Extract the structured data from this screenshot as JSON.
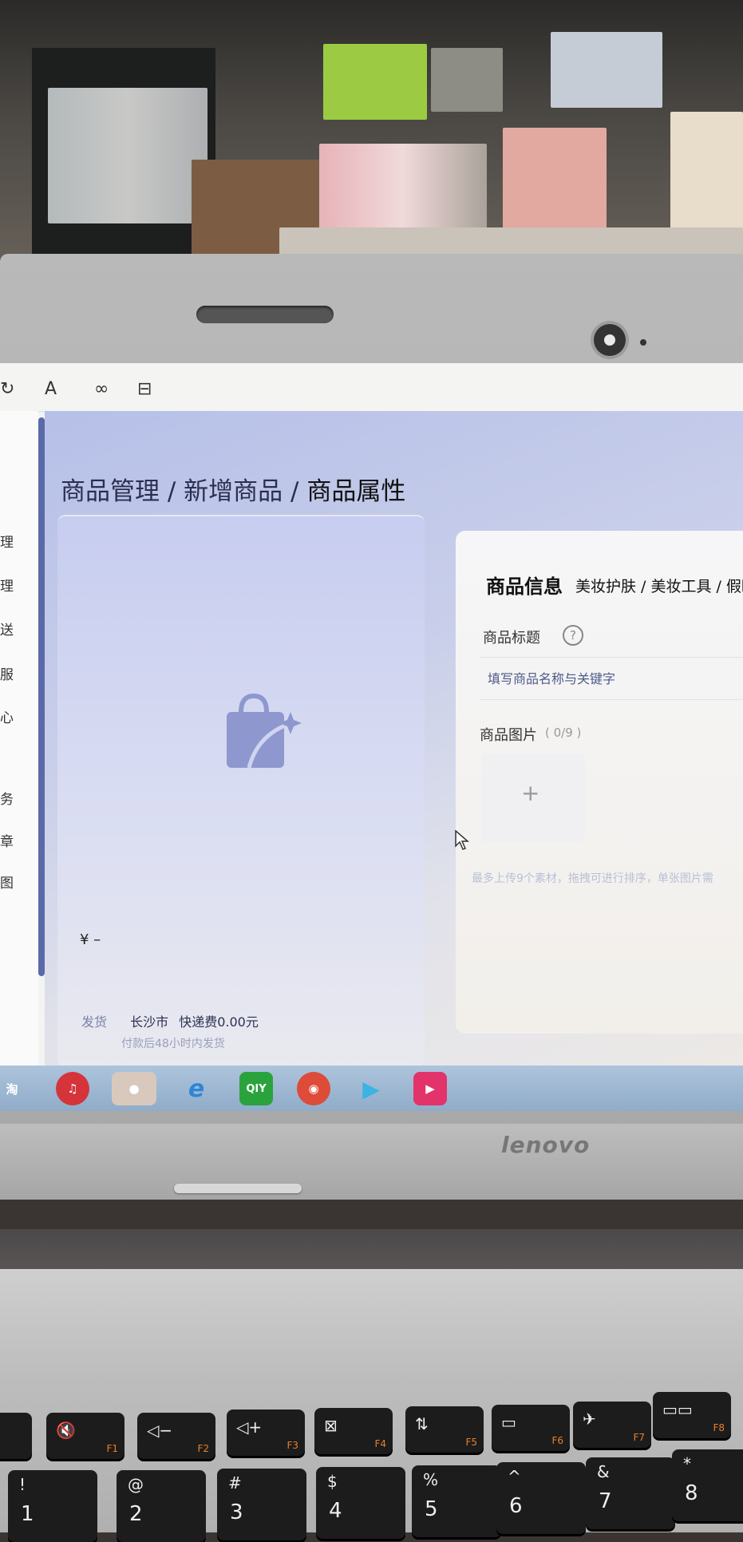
{
  "toolbar": {
    "icons": [
      "redo-icon",
      "text-icon",
      "link-icon",
      "layout-icon"
    ],
    "text_button": "A"
  },
  "sidebar": {
    "items": [
      {
        "label": "理"
      },
      {
        "label": "理"
      },
      {
        "label": "送"
      },
      {
        "label": "服"
      },
      {
        "label": "心"
      },
      {
        "label": "务"
      },
      {
        "label": "章"
      },
      {
        "label": "图"
      }
    ]
  },
  "breadcrumb": {
    "level1": "商品管理",
    "sep1": "/",
    "level2": "新增商品",
    "sep2": "/",
    "level3": "商品属性"
  },
  "preview": {
    "price": "¥ –",
    "ship_label": "发货",
    "ship_city": "长沙市",
    "ship_fee": "快递费0.00元",
    "ship_note": "付款后48小时内发货"
  },
  "info": {
    "title": "商品信息",
    "categories": "美妆护肤 / 美妆工具 / 假睫",
    "field_title_label": "商品标题",
    "help": "?",
    "title_placeholder": "填写商品名称与关键字",
    "image_label": "商品图片",
    "image_count": "( 0/9 )",
    "upload_plus": "+",
    "upload_hint": "最多上传9个素材，拖拽可进行排序，单张图片需"
  },
  "taskbar": {
    "items": [
      {
        "label": "淘",
        "icon": "taobao-icon",
        "color": "#f05a22"
      },
      {
        "label": "♫",
        "icon": "netease-music-icon",
        "color": "#d5343a"
      },
      {
        "label": "●",
        "icon": "wechat-icon",
        "color": "#3dbb49"
      },
      {
        "label": "e",
        "icon": "ie-icon",
        "color": "#2d86d6"
      },
      {
        "label": "QIY",
        "icon": "iqiyi-icon",
        "color": "#2aa33c"
      },
      {
        "label": "◉",
        "icon": "chrome-icon",
        "color": "#dd4b39"
      },
      {
        "label": "▶",
        "icon": "media-player-icon",
        "color": "#3bb3e3"
      },
      {
        "label": "▶",
        "icon": "youku-icon",
        "color": "#e2336b"
      }
    ]
  },
  "brand": "lenovo",
  "keyboard": {
    "fn_row": [
      {
        "main": "🔇",
        "fn": "F1"
      },
      {
        "main": "◁−",
        "fn": "F2"
      },
      {
        "main": "◁+",
        "fn": "F3"
      },
      {
        "main": "⊠",
        "fn": "F4"
      },
      {
        "main": "⇅",
        "fn": "F5"
      },
      {
        "main": "▭",
        "fn": "F6"
      },
      {
        "main": "✈",
        "fn": "F7"
      },
      {
        "main": "▭▭",
        "fn": "F8"
      }
    ],
    "num_row": [
      {
        "top": "!",
        "bot": "1"
      },
      {
        "top": "@",
        "bot": "2"
      },
      {
        "top": "#",
        "bot": "3"
      },
      {
        "top": "$",
        "bot": "4"
      },
      {
        "top": "%",
        "bot": "5"
      },
      {
        "top": "^",
        "bot": "6"
      },
      {
        "top": "&",
        "bot": "7"
      },
      {
        "top": "*",
        "bot": "8"
      }
    ]
  }
}
